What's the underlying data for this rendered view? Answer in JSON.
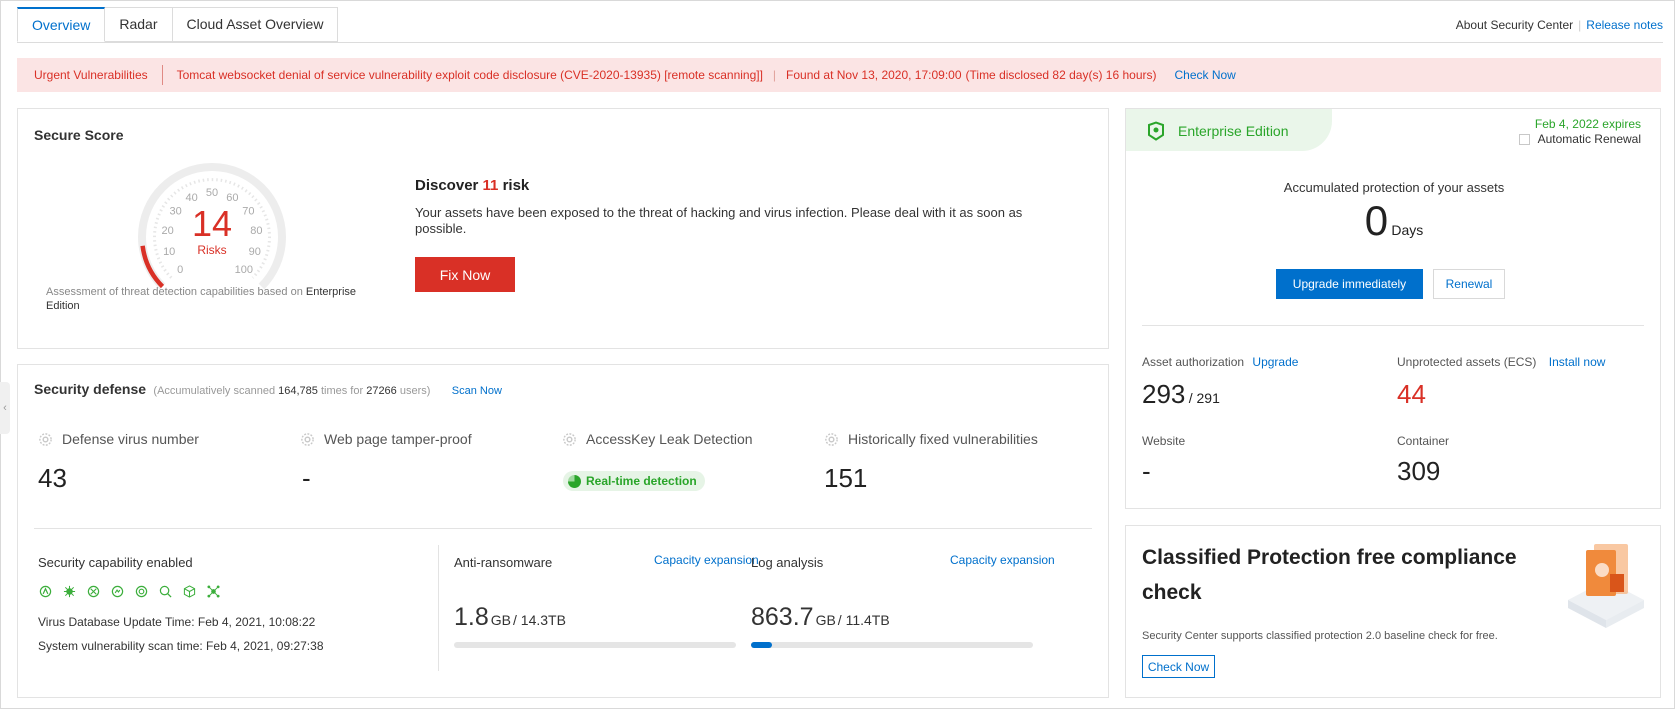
{
  "tabs": [
    {
      "label": "Overview",
      "active": true
    },
    {
      "label": "Radar",
      "active": false
    },
    {
      "label": "Cloud Asset Overview",
      "active": false
    }
  ],
  "header_links": {
    "about": "About Security Center",
    "release_notes": "Release notes"
  },
  "alert": {
    "tag": "Urgent Vulnerabilities",
    "message": "Tomcat websocket denial of service vulnerability exploit code disclosure (CVE-2020-13935) [remote scanning]]",
    "found": "Found at Nov 13, 2020, 17:09:00",
    "disclosed": "(Time disclosed 82 day(s) 16 hours)",
    "action": "Check Now"
  },
  "secure_score": {
    "title": "Secure Score",
    "gauge_ticks": [
      "0",
      "10",
      "20",
      "30",
      "40",
      "50",
      "60",
      "70",
      "80",
      "90",
      "100"
    ],
    "risk_count": "14",
    "risk_label": "Risks",
    "gauge_level_fraction": 0.14,
    "footnote_prefix": "Assessment of threat detection capabilities based on ",
    "footnote_edition": "Enterprise Edition",
    "discover_prefix": "Discover ",
    "discover_count": "11",
    "discover_suffix": " risk",
    "description": "Your assets have been exposed to the threat of hacking and virus infection. Please deal with it as soon as possible.",
    "fix_button": "Fix Now"
  },
  "security_defense": {
    "title": "Security defense",
    "scan_prefix": "(Accumulatively scanned ",
    "scan_count": "164,785",
    "scan_mid": " times for ",
    "scan_users": "27266",
    "scan_suffix": " users)",
    "scan_now": "Scan Now",
    "metrics": [
      {
        "label": "Defense virus number",
        "value": "43"
      },
      {
        "label": "Web page tamper-proof",
        "value": "-"
      },
      {
        "label": "AccessKey Leak Detection",
        "value": "Real-time detection"
      },
      {
        "label": "Historically fixed vulnerabilities",
        "value": "151"
      }
    ],
    "capability_title": "Security capability enabled",
    "capability_icons": [
      "shield-a-icon",
      "bug-icon",
      "grid-icon",
      "virus-icon",
      "target-icon",
      "search-bug-icon",
      "cube-icon",
      "network-icon"
    ],
    "virus_db_update": "Virus Database Update Time: Feb 4, 2021, 10:08:22",
    "vuln_scan_time": "System vulnerability scan time: Feb 4, 2021, 09:27:38",
    "anti_ransomware": {
      "title": "Anti-ransomware",
      "link": "Capacity expansion",
      "used": "1.8",
      "unit": "GB",
      "total": "/ 14.3TB",
      "usage_fraction": 0.0
    },
    "log_analysis": {
      "title": "Log analysis",
      "link": "Capacity expansion",
      "used": "863.7",
      "unit": "GB",
      "total": "/ 11.4TB",
      "usage_fraction": 0.074
    }
  },
  "edition": {
    "name": "Enterprise Edition",
    "expires": "Feb 4, 2022 expires",
    "auto_renew": "Automatic Renewal",
    "protection_label": "Accumulated protection of your assets",
    "protection_days": "0",
    "days_unit": "Days",
    "upgrade_button": "Upgrade immediately",
    "renew_button": "Renewal",
    "asset_auth_label": "Asset authorization",
    "asset_auth_link": "Upgrade",
    "asset_auth_value": "293",
    "asset_auth_total": "/ 291",
    "unprotected_label": "Unprotected assets (ECS)",
    "unprotected_link": "Install now",
    "unprotected_value": "44",
    "website_label": "Website",
    "website_value": "-",
    "container_label": "Container",
    "container_value": "309"
  },
  "compliance": {
    "title": "Classified Protection free compliance check",
    "description": "Security Center supports classified protection 2.0 baseline check for free.",
    "button": "Check Now"
  },
  "colors": {
    "accent": "#0070cc",
    "danger": "#d93026",
    "success": "#2aa52a",
    "alert_bg": "#fbe4e4"
  }
}
